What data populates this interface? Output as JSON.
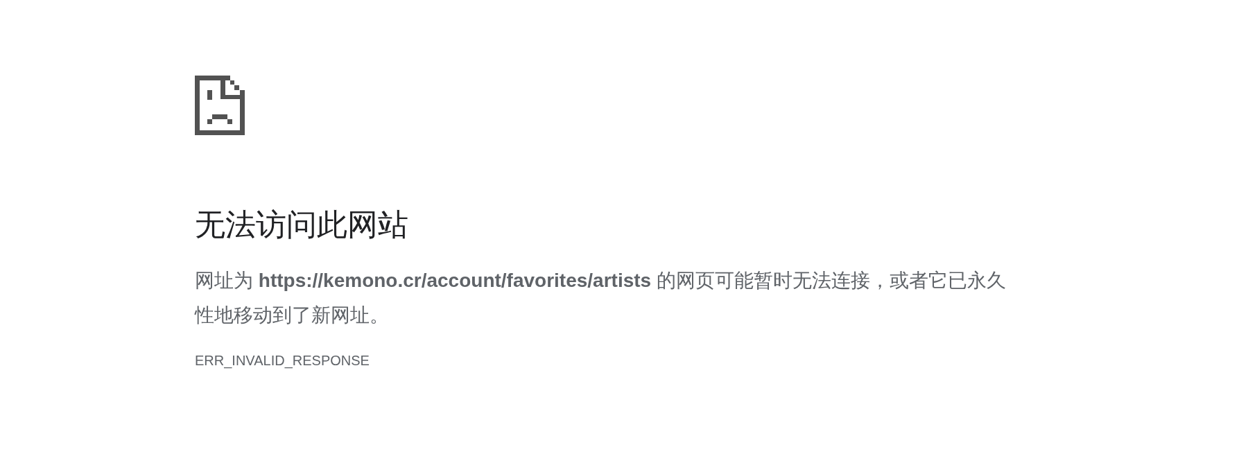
{
  "heading": "无法访问此网站",
  "message": "网址为 **https://kemono.cr/account/favorites/artists** 的网页可能暂时无法连接，或者它已永久性地移动到了新网址。",
  "error_code": "ERR_INVALID_RESPONSE"
}
